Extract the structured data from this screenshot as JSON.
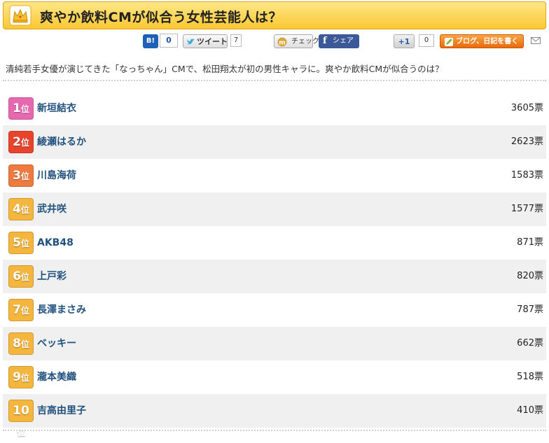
{
  "header": {
    "title": "爽やか飲料CMが似合う女性芸能人は？",
    "icon": "crown-icon"
  },
  "social": {
    "hatena_label": "B!",
    "hatena_count": "0",
    "tweet_label": "ツイート",
    "tweet_count": "7",
    "check_label": "チェック",
    "share_label": "シェア",
    "plus1_label": "+1",
    "plus1_count": "0",
    "blog_label": "ブログ、日記を書く"
  },
  "description": "清純若手女優が演じてきた「なっちゃん」CMで、松田翔太が初の男性キャラに。爽やか飲料CMが似合うのは？",
  "rankings": [
    {
      "rank": "1",
      "unit": "位",
      "name": "新垣結衣",
      "votes": "3605票",
      "badge_color": "#e868b0"
    },
    {
      "rank": "2",
      "unit": "位",
      "name": "綾瀬はるか",
      "votes": "2623票",
      "badge_color": "#e8442c"
    },
    {
      "rank": "3",
      "unit": "位",
      "name": "川島海荷",
      "votes": "1583票",
      "badge_color": "#ee7a40"
    },
    {
      "rank": "4",
      "unit": "位",
      "name": "武井咲",
      "votes": "1577票",
      "badge_color": "#f4b63c"
    },
    {
      "rank": "5",
      "unit": "位",
      "name": "AKB48",
      "votes": "871票",
      "badge_color": "#f4b63c"
    },
    {
      "rank": "6",
      "unit": "位",
      "name": "上戸彩",
      "votes": "820票",
      "badge_color": "#f4b63c"
    },
    {
      "rank": "7",
      "unit": "位",
      "name": "長澤まさみ",
      "votes": "787票",
      "badge_color": "#f4b63c"
    },
    {
      "rank": "8",
      "unit": "位",
      "name": "ベッキー",
      "votes": "662票",
      "badge_color": "#f4b63c"
    },
    {
      "rank": "9",
      "unit": "位",
      "name": "瀧本美織",
      "votes": "518票",
      "badge_color": "#f4b63c"
    },
    {
      "rank": "10",
      "unit": "位",
      "name": "吉高由里子",
      "votes": "410票",
      "badge_color": "#f4b63c"
    }
  ]
}
